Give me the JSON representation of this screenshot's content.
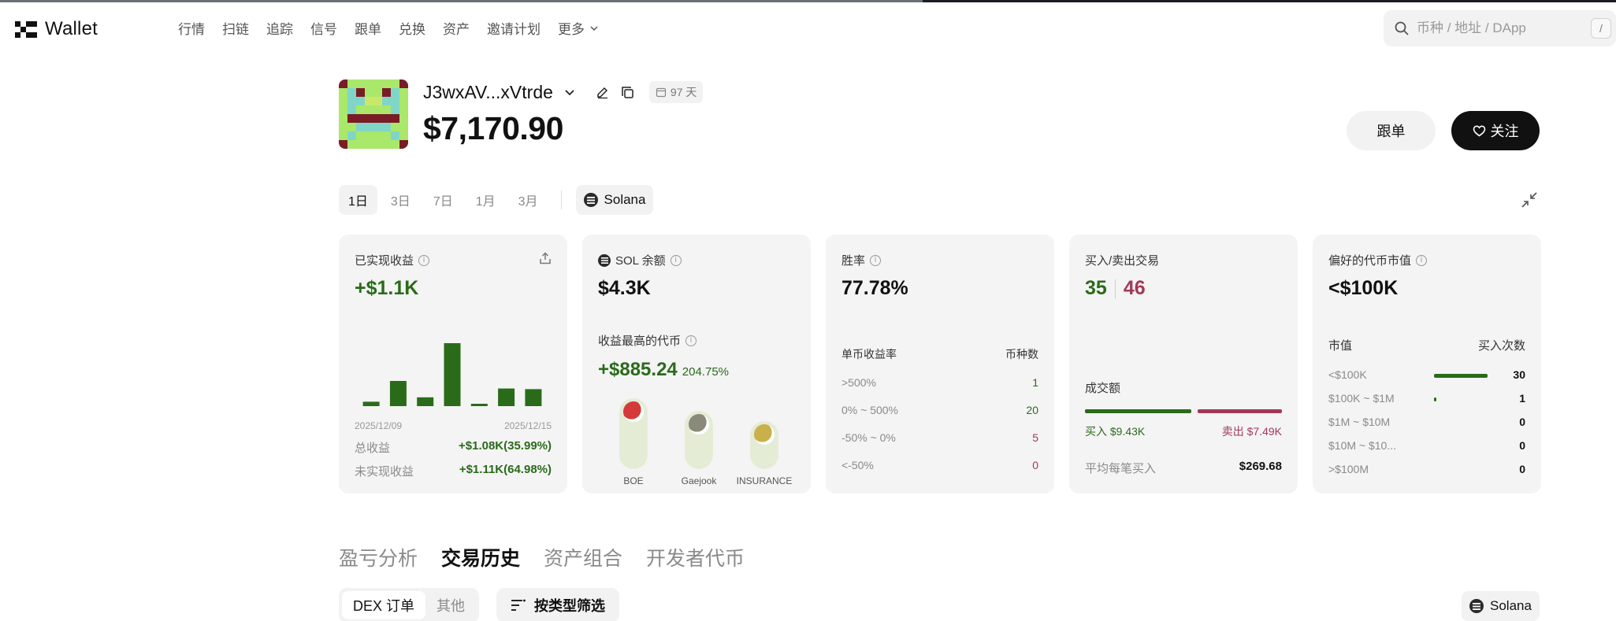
{
  "brand": {
    "logo_text": "Wallet"
  },
  "nav": {
    "items": [
      "行情",
      "扫链",
      "追踪",
      "信号",
      "跟单",
      "兑换",
      "资产",
      "邀请计划"
    ],
    "more_label": "更多"
  },
  "search": {
    "placeholder": "币种 / 地址 / DApp",
    "shortcut": "/"
  },
  "profile": {
    "address": "J3wxAV...xVtrde",
    "age": "97 天",
    "balance": "$7,170.90",
    "follow_order_label": "跟单",
    "watch_label": "关注"
  },
  "ranges": {
    "options": [
      "1日",
      "3日",
      "7日",
      "1月",
      "3月"
    ],
    "active": "1日",
    "chain": "Solana"
  },
  "cards": {
    "realized": {
      "title": "已实现收益",
      "value": "+$1.1K",
      "bars": [
        0.07,
        0.4,
        0.14,
        1.0,
        0.03,
        0.28,
        0.27
      ],
      "date_start": "2025/12/09",
      "date_end": "2025/12/15",
      "total_label": "总收益",
      "total_value": "+$1.08K(35.99%)",
      "unrealized_label": "未实现收益",
      "unrealized_value": "+$1.11K(64.98%)"
    },
    "sol": {
      "title": "SOL 余额",
      "value": "$4.3K",
      "top_title": "收益最高的代币",
      "top_amount": "+$885.24",
      "top_pct": "204.75%",
      "tokens": [
        {
          "name": "BOE",
          "level": 1.0,
          "color": "#d43a3a"
        },
        {
          "name": "Gaejook",
          "level": 0.72,
          "color": "#8a8a7a"
        },
        {
          "name": "INSURANCE",
          "level": 0.48,
          "color": "#c9b04a"
        }
      ]
    },
    "winrate": {
      "title": "胜率",
      "value": "77.78%",
      "col_rate": "单币收益率",
      "col_count": "币种数",
      "rows": [
        {
          "range": ">500%",
          "count": "1",
          "tone": "green"
        },
        {
          "range": "0% ~ 500%",
          "count": "20",
          "tone": "green"
        },
        {
          "range": "-50% ~ 0%",
          "count": "5",
          "tone": "red"
        },
        {
          "range": "<-50%",
          "count": "0",
          "tone": "red"
        }
      ]
    },
    "trades": {
      "title": "买入/卖出交易",
      "buys": "35",
      "sells": "46",
      "volume_label": "成交额",
      "buy_share": 0.557,
      "buy_volume": "买入 $9.43K",
      "sell_volume": "卖出 $7.49K",
      "avg_label": "平均每笔买入",
      "avg_value": "$269.68"
    },
    "mcap": {
      "title": "偏好的代币市值",
      "value": "<$100K",
      "col_mcap": "市值",
      "col_buys": "买入次数",
      "rows": [
        {
          "range": "<$100K",
          "count": "30",
          "share": 1.0
        },
        {
          "range": "$100K ~ $1M",
          "count": "1",
          "share": 0.033
        },
        {
          "range": "$1M ~ $10M",
          "count": "0",
          "share": 0
        },
        {
          "range": "$10M ~ $10...",
          "count": "0",
          "share": 0
        },
        {
          "range": ">$100M",
          "count": "0",
          "share": 0
        }
      ]
    }
  },
  "sections": {
    "tabs": [
      "盈亏分析",
      "交易历史",
      "资产组合",
      "开发者代币"
    ],
    "active": "交易历史"
  },
  "history": {
    "sub_tabs": [
      "DEX 订单",
      "其他"
    ],
    "active_sub": "DEX 订单",
    "filter_label": "按类型筛选",
    "chain": "Solana"
  },
  "colors": {
    "green": "#2a6b1a",
    "red": "#a13a57",
    "card_bg": "#f4f4f4"
  }
}
